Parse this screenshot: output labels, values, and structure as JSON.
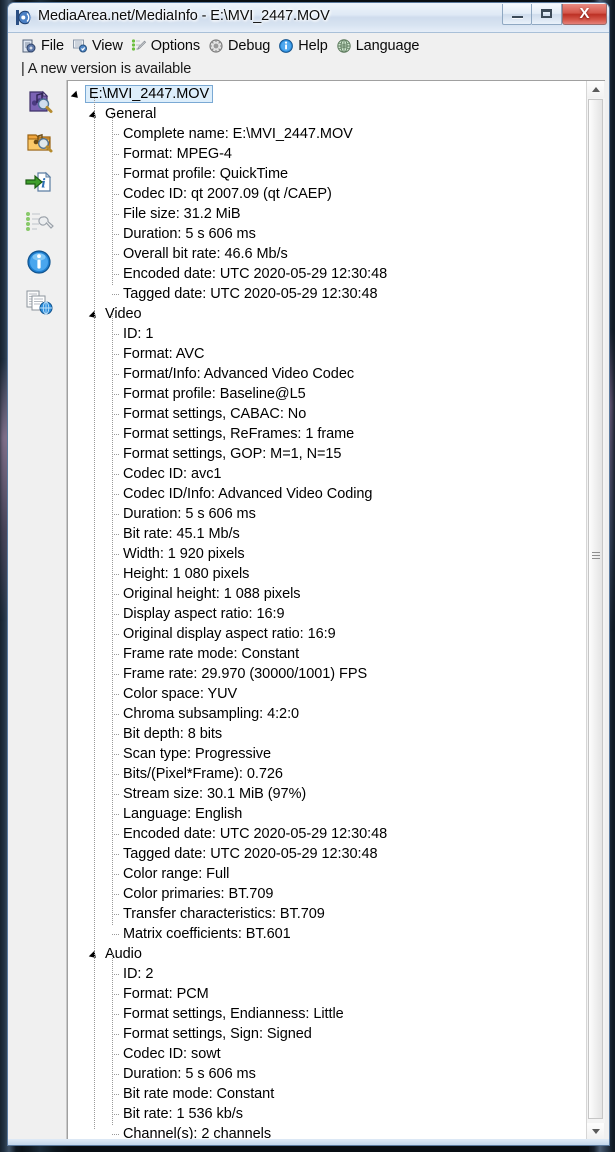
{
  "window": {
    "title": "MediaArea.net/MediaInfo - E:\\MVI_2447.MOV",
    "app_icon": "mediainfo-icon",
    "controls": {
      "minimize": "minimize-button",
      "maximize": "maximize-button",
      "close": "close-button",
      "close_glyph": "X"
    }
  },
  "menu": {
    "items": [
      {
        "label": "File",
        "icon": "file-icon"
      },
      {
        "label": "View",
        "icon": "view-icon"
      },
      {
        "label": "Options",
        "icon": "options-icon"
      },
      {
        "label": "Debug",
        "icon": "debug-icon"
      },
      {
        "label": "Help",
        "icon": "help-icon"
      },
      {
        "label": "Language",
        "icon": "language-icon"
      }
    ]
  },
  "notification": {
    "text": "| A new version is available"
  },
  "sidebar": {
    "items": [
      {
        "name": "open-file-icon"
      },
      {
        "name": "open-folder-icon"
      },
      {
        "name": "export-info-icon"
      },
      {
        "name": "preferences-icon"
      },
      {
        "name": "about-info-icon"
      },
      {
        "name": "export-report-icon"
      }
    ]
  },
  "tree": {
    "root": "E:\\MVI_2447.MOV",
    "sections": [
      {
        "label": "General",
        "rows": [
          "Complete name: E:\\MVI_2447.MOV",
          "Format: MPEG-4",
          "Format profile: QuickTime",
          "Codec ID: qt   2007.09 (qt  /CAEP)",
          "File size: 31.2 MiB",
          "Duration: 5 s 606 ms",
          "Overall bit rate: 46.6 Mb/s",
          "Encoded date: UTC 2020-05-29 12:30:48",
          "Tagged date: UTC 2020-05-29 12:30:48"
        ]
      },
      {
        "label": "Video",
        "rows": [
          "ID: 1",
          "Format: AVC",
          "Format/Info: Advanced Video Codec",
          "Format profile: Baseline@L5",
          "Format settings, CABAC: No",
          "Format settings, ReFrames: 1 frame",
          "Format settings, GOP: M=1, N=15",
          "Codec ID: avc1",
          "Codec ID/Info: Advanced Video Coding",
          "Duration: 5 s 606 ms",
          "Bit rate: 45.1 Mb/s",
          "Width: 1 920 pixels",
          "Height: 1 080 pixels",
          "Original height: 1 088 pixels",
          "Display aspect ratio: 16:9",
          "Original display aspect ratio: 16:9",
          "Frame rate mode: Constant",
          "Frame rate: 29.970 (30000/1001) FPS",
          "Color space: YUV",
          "Chroma subsampling: 4:2:0",
          "Bit depth: 8 bits",
          "Scan type: Progressive",
          "Bits/(Pixel*Frame): 0.726",
          "Stream size: 30.1 MiB (97%)",
          "Language: English",
          "Encoded date: UTC 2020-05-29 12:30:48",
          "Tagged date: UTC 2020-05-29 12:30:48",
          "Color range: Full",
          "Color primaries: BT.709",
          "Transfer characteristics: BT.709",
          "Matrix coefficients: BT.601"
        ]
      },
      {
        "label": "Audio",
        "rows": [
          "ID: 2",
          "Format: PCM",
          "Format settings, Endianness: Little",
          "Format settings, Sign: Signed",
          "Codec ID: sowt",
          "Duration: 5 s 606 ms",
          "Bit rate mode: Constant",
          "Bit rate: 1 536 kb/s",
          "Channel(s): 2 channels"
        ]
      }
    ]
  },
  "scrollbar": {
    "up_arrow": "scroll-up-arrow",
    "down_arrow": "scroll-down-arrow"
  },
  "colors": {
    "accent": "#7aa9d4",
    "selection_fill": "#ddeefb",
    "panel_bg": "#f0f0f0",
    "tree_bg": "#ffffff",
    "close_button": "#bc3024"
  }
}
